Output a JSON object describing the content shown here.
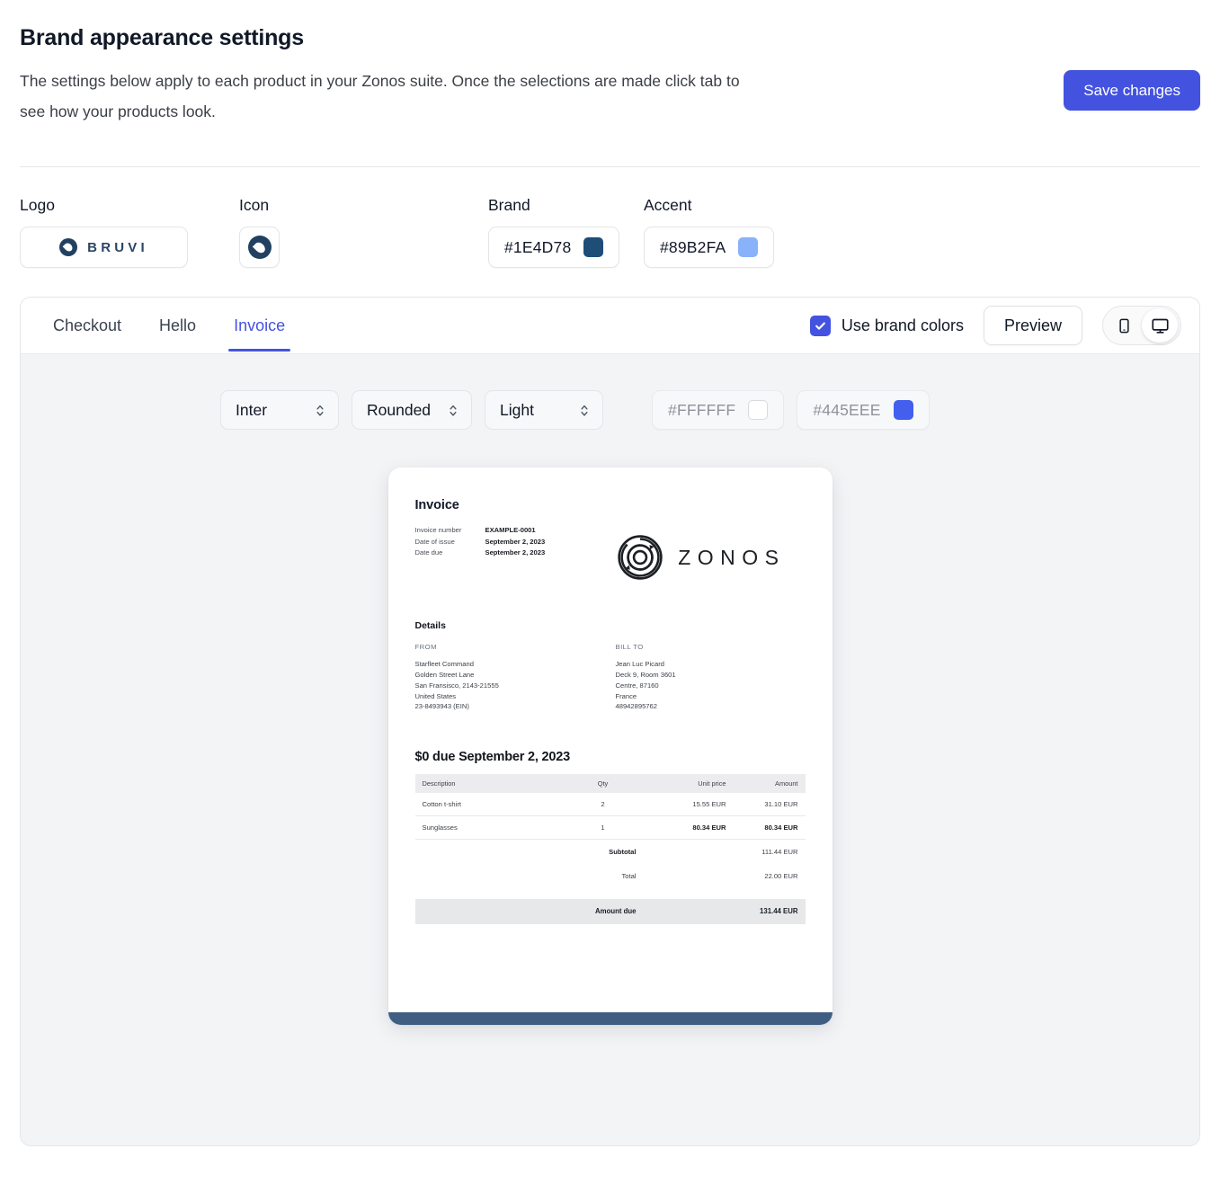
{
  "header": {
    "title": "Brand appearance settings",
    "description": "The settings below apply to each product in your Zonos suite. Once the selections are made click tab to see how your products look.",
    "save_label": "Save changes"
  },
  "brand_row": {
    "logo_label": "Logo",
    "logo_wordmark": "BRUVI",
    "icon_label": "Icon",
    "brand_label": "Brand",
    "brand_value": "#1E4D78",
    "accent_label": "Accent",
    "accent_value": "#89B2FA"
  },
  "panel": {
    "tabs": [
      {
        "label": "Checkout",
        "active": false
      },
      {
        "label": "Hello",
        "active": false
      },
      {
        "label": "Invoice",
        "active": true
      }
    ],
    "use_brand_colors_label": "Use brand colors",
    "use_brand_colors_checked": true,
    "preview_label": "Preview",
    "devices": [
      {
        "name": "mobile",
        "active": false
      },
      {
        "name": "desktop",
        "active": true
      }
    ]
  },
  "controls": {
    "font": "Inter",
    "corners": "Rounded",
    "theme": "Light",
    "background_color": "#FFFFFF",
    "primary_color": "#445EEE"
  },
  "invoice": {
    "title": "Invoice",
    "meta": [
      {
        "key": "Invoice number",
        "value": "EXAMPLE-0001"
      },
      {
        "key": "Date of issue",
        "value": "September 2, 2023"
      },
      {
        "key": "Date due",
        "value": "September 2, 2023"
      }
    ],
    "logo_word": "ZONOS",
    "details_heading": "Details",
    "from_heading": "FROM",
    "from_lines": [
      "Starfleet Command",
      "Golden Street Lane",
      "San Fransisco, 2143-21555",
      "United States",
      "23-8493943 (EIN)"
    ],
    "bill_to_heading": "BILL TO",
    "bill_to_lines": [
      "Jean Luc Picard",
      "Deck 9, Room 3601",
      "Centre, 87160",
      "France",
      "48942895762"
    ],
    "amount_due_heading": "$0 due September 2, 2023",
    "columns": {
      "description": "Description",
      "qty": "Qty",
      "unit_price": "Unit price",
      "amount": "Amount"
    },
    "line_items": [
      {
        "description": "Cotton t-shirt",
        "qty": "2",
        "unit_price": "15.55 EUR",
        "amount": "31.10 EUR"
      },
      {
        "description": "Sunglasses",
        "qty": "1",
        "unit_price": "80.34 EUR",
        "amount": "80.34 EUR"
      }
    ],
    "totals": [
      {
        "label": "Subtotal",
        "value": "111.44 EUR",
        "bold": true
      },
      {
        "label": "Total",
        "value": "22.00 EUR",
        "bold": false
      }
    ],
    "amount_due_label": "Amount due",
    "amount_due_value": "131.44 EUR"
  },
  "colors": {
    "accent_blue": "#4353E0",
    "brand_navy": "#1E4D78",
    "brand_accent": "#89B2FA",
    "preview_bg": "#445EEE",
    "card_footer": "#3F5E82"
  }
}
